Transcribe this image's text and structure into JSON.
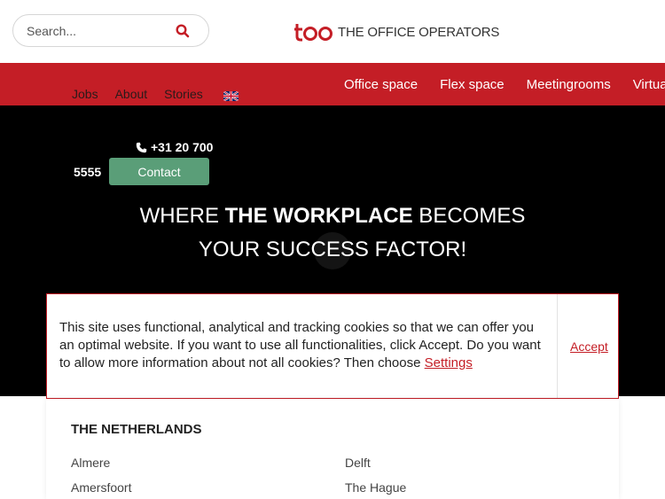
{
  "search": {
    "placeholder": "Search..."
  },
  "brand": {
    "name": "THE OFFICE OPERATORS",
    "color": "#c41e26"
  },
  "nav": {
    "secondary": [
      "Jobs",
      "About",
      "Stories"
    ],
    "language_icon": "uk-flag-icon",
    "main": [
      "Office space",
      "Flex space",
      "Meetingrooms",
      "Virtual office"
    ]
  },
  "hero": {
    "phone": "+31 20 700",
    "phone_cont": "5555",
    "contact_label": "Contact",
    "title_pre": "WHERE ",
    "title_bold": "THE WORKPLACE",
    "title_post": " BECOMES",
    "title_line2": "YOUR SUCCESS FACTOR!"
  },
  "cookie": {
    "text": "This site uses functional, analytical and tracking cookies so that we can offer you an optimal website. If you want to use all functionalities, click Accept. Do you want to allow more information about not all cookies? Then choose ",
    "settings_label": "Settings",
    "accept_label": "Accept"
  },
  "locations": {
    "title": "THE NETHERLANDS",
    "col1": [
      "Almere",
      "Amersfoort"
    ],
    "col2": [
      "Delft",
      "The Hague"
    ]
  }
}
